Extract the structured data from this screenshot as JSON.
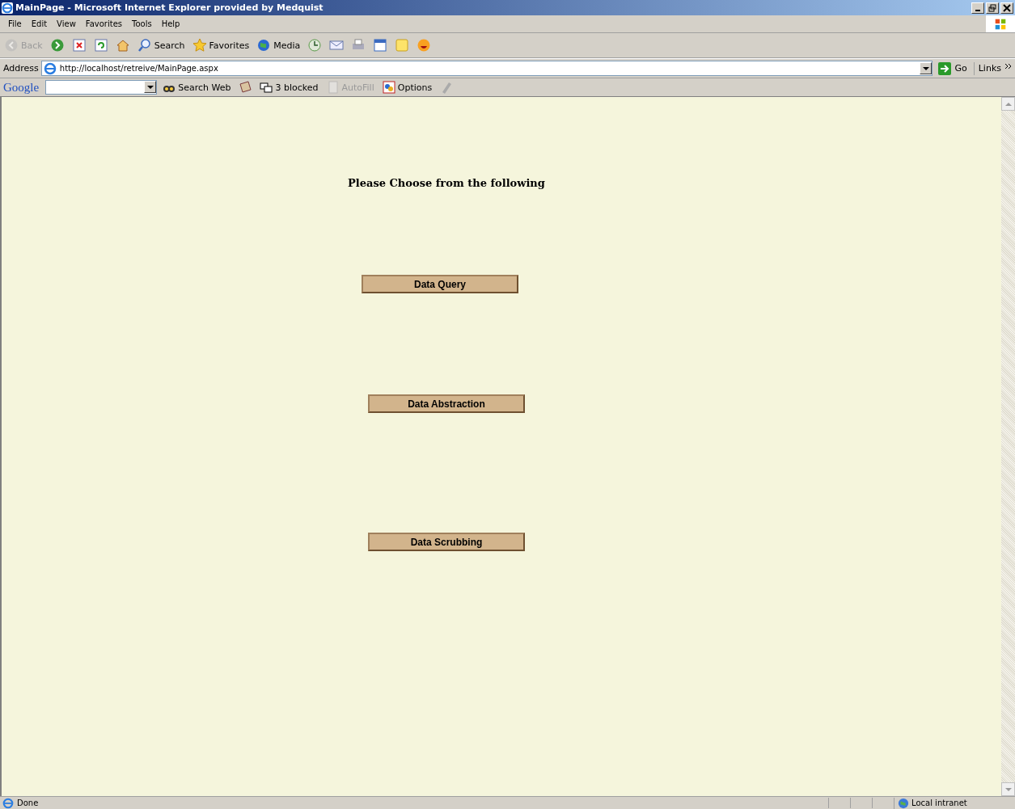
{
  "window": {
    "title": "MainPage - Microsoft Internet Explorer provided by Medquist"
  },
  "menu": [
    "File",
    "Edit",
    "View",
    "Favorites",
    "Tools",
    "Help"
  ],
  "toolbar": [
    {
      "kind": "back",
      "label": "Back",
      "disabled": true
    },
    {
      "kind": "forward",
      "disabled": false
    },
    {
      "kind": "stop",
      "disabled": false
    },
    {
      "kind": "refresh",
      "disabled": false
    },
    {
      "kind": "home",
      "disabled": false
    },
    {
      "kind": "search",
      "label": "Search",
      "disabled": false
    },
    {
      "kind": "favorites",
      "label": "Favorites",
      "disabled": false
    },
    {
      "kind": "media",
      "label": "Media",
      "disabled": false
    },
    {
      "kind": "history",
      "disabled": false
    },
    {
      "kind": "mail",
      "disabled": false
    },
    {
      "kind": "print",
      "disabled": false
    },
    {
      "kind": "edit",
      "disabled": false
    },
    {
      "kind": "note",
      "disabled": false
    },
    {
      "kind": "messenger",
      "disabled": false
    }
  ],
  "address": {
    "label": "Address",
    "url": "http://localhost/retreive/MainPage.aspx",
    "go": "Go",
    "links": "Links"
  },
  "google_toolbar": {
    "logo": "Google",
    "items": [
      {
        "kind": "search",
        "label": "Search Web",
        "disabled": false
      },
      {
        "kind": "news",
        "disabled": false
      },
      {
        "kind": "popup",
        "label": "3 blocked",
        "disabled": false
      },
      {
        "kind": "autofill",
        "label": "AutoFill",
        "disabled": true
      },
      {
        "kind": "options",
        "label": "Options",
        "disabled": false
      },
      {
        "kind": "highlight",
        "disabled": false
      }
    ]
  },
  "page": {
    "heading": "Please Choose from the following",
    "buttons": [
      "Data Query",
      "Data Abstraction",
      "Data Scrubbing"
    ]
  },
  "status_bar": {
    "text": "Done",
    "zone": "Local intranet"
  }
}
